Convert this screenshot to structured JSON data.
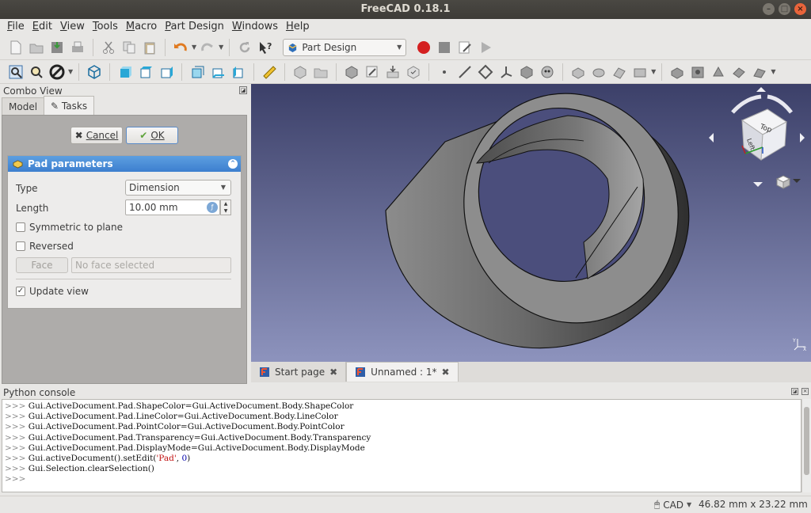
{
  "window": {
    "title": "FreeCAD 0.18.1"
  },
  "menu": [
    {
      "label": "File",
      "key": "F",
      "rest": "ile"
    },
    {
      "label": "Edit",
      "key": "E",
      "rest": "dit"
    },
    {
      "label": "View",
      "key": "V",
      "rest": "iew"
    },
    {
      "label": "Tools",
      "key": "T",
      "rest": "ools"
    },
    {
      "label": "Macro",
      "key": "M",
      "rest": "acro"
    },
    {
      "label": "Part Design",
      "key": "P",
      "rest": "art Design"
    },
    {
      "label": "Windows",
      "key": "W",
      "rest": "indows"
    },
    {
      "label": "Help",
      "key": "H",
      "rest": "elp"
    }
  ],
  "workbench": {
    "selected": "Part Design"
  },
  "combo_view": {
    "title": "Combo View",
    "tabs": {
      "model": "Model",
      "tasks": "Tasks"
    },
    "cancel_label": "Cancel",
    "ok_label": "OK"
  },
  "pad": {
    "title": "Pad parameters",
    "type_label": "Type",
    "type_value": "Dimension",
    "length_label": "Length",
    "length_value": "10.00 mm",
    "symmetric_label": "Symmetric to plane",
    "symmetric_checked": false,
    "reversed_label": "Reversed",
    "reversed_checked": false,
    "face_button": "Face",
    "face_placeholder": "No face selected",
    "update_label": "Update view",
    "update_checked": true
  },
  "navcube": {
    "top": "Top",
    "left": "Left"
  },
  "doc_tabs": {
    "start": "Start page",
    "unnamed": "Unnamed : 1*"
  },
  "python_console": {
    "title": "Python console",
    "prompt": ">>>",
    "lines": [
      "Gui.ActiveDocument.Pad.ShapeColor=Gui.ActiveDocument.Body.ShapeColor",
      "Gui.ActiveDocument.Pad.LineColor=Gui.ActiveDocument.Body.LineColor",
      "Gui.ActiveDocument.Pad.PointColor=Gui.ActiveDocument.Body.PointColor",
      "Gui.ActiveDocument.Pad.Transparency=Gui.ActiveDocument.Body.Transparency",
      "Gui.ActiveDocument.Pad.DisplayMode=Gui.ActiveDocument.Body.DisplayMode"
    ],
    "setedit_prefix": "Gui.activeDocument().setEdit(",
    "setedit_str": "'Pad'",
    "setedit_sep": ", ",
    "setedit_num": "0",
    "setedit_suffix": ")",
    "clear_line": "Gui.Selection.clearSelection()"
  },
  "status": {
    "nav_style": "CAD",
    "dimensions": "46.82 mm x 23.22 mm"
  },
  "colors": {
    "accent": "#3d7fcf",
    "view_top": "#3c4069",
    "view_bottom": "#8d93bd",
    "record": "#d42020"
  }
}
